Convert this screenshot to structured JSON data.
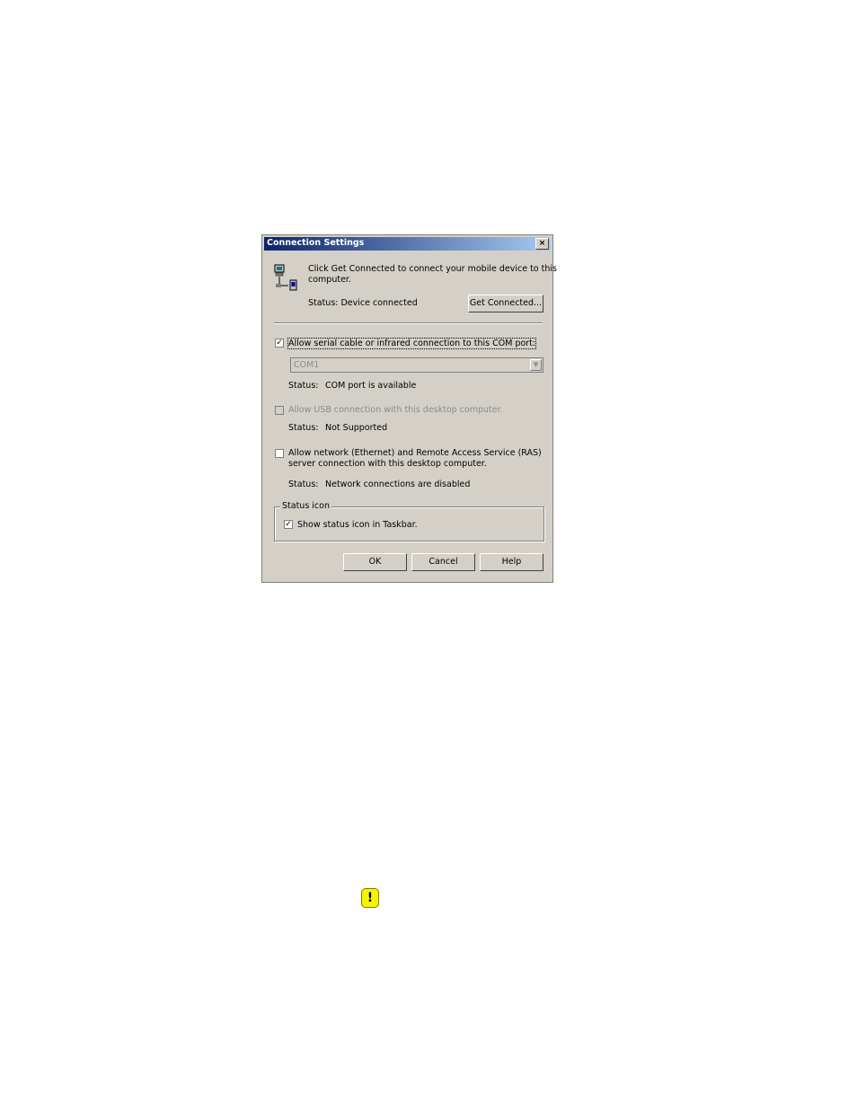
{
  "dialog": {
    "title": "Connection Settings",
    "close_label": "×",
    "intro_text_line1": "Click Get Connected to connect your mobile device to this",
    "intro_text_line2": "computer.",
    "device_status": "Status: Device connected",
    "get_connected_label": "Get Connected...",
    "serial_checkbox": {
      "checked": true,
      "label": "Allow serial cable or infrared connection to this COM port:"
    },
    "com_port": {
      "value": "COM1",
      "options": [
        "COM1"
      ]
    },
    "com_status_label": "Status:",
    "com_status_value": "COM port is available",
    "usb_checkbox": {
      "checked": false,
      "enabled": false,
      "label": "Allow USB connection with this desktop computer."
    },
    "usb_status_label": "Status:",
    "usb_status_value": "Not Supported",
    "network_checkbox": {
      "checked": false,
      "label_line1": "Allow network (Ethernet) and Remote Access Service (RAS)",
      "label_line2": "server connection with this desktop computer."
    },
    "network_status_label": "Status:",
    "network_status_value": "Network connections are disabled",
    "status_icon_group": {
      "title": "Status icon",
      "show_icon_checkbox": {
        "checked": true,
        "label": "Show status icon in Taskbar."
      }
    },
    "buttons": {
      "ok": "OK",
      "cancel": "Cancel",
      "help": "Help"
    }
  },
  "icons": {
    "computer": "computer-connection-icon",
    "warning": "warning-icon"
  },
  "colors": {
    "titlebar_start": "#0a246a",
    "titlebar_end": "#a6caf0",
    "dialog_bg": "#d4d0c8",
    "warning_yellow": "#f5f500"
  }
}
